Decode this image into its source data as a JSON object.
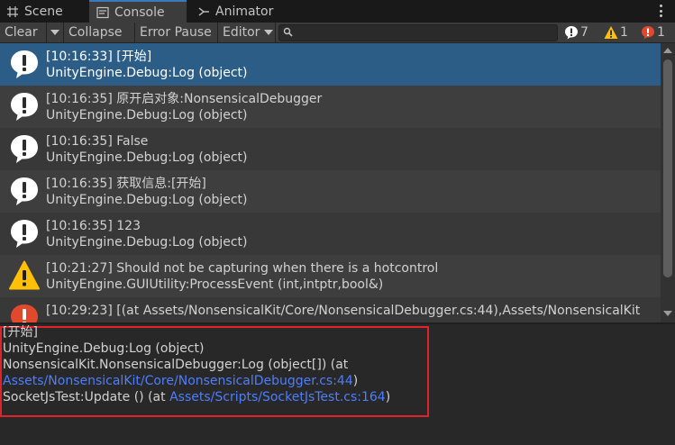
{
  "tabs": [
    {
      "label": "Scene",
      "icon": "scene-grid-icon"
    },
    {
      "label": "Console",
      "icon": "console-icon"
    },
    {
      "label": "Animator",
      "icon": "animator-icon"
    }
  ],
  "toolbar": {
    "clear_label": "Clear",
    "collapse_label": "Collapse",
    "error_pause_label": "Error Pause",
    "editor_label": "Editor",
    "search_placeholder": "",
    "counts": {
      "info": "7",
      "warning": "1",
      "error": "1"
    }
  },
  "colors": {
    "selected_row": "#2c5d87",
    "warning_icon": "#ffc107",
    "error_icon": "#e0492e",
    "link": "#4c7eff",
    "highlight_box": "#e0232a"
  },
  "logs": [
    {
      "type": "info",
      "line1": "[10:16:33] [开始]",
      "line2": "UnityEngine.Debug:Log (object)",
      "selected": true
    },
    {
      "type": "info",
      "line1": "[10:16:35] 原开启对象:NonsensicalDebugger",
      "line2": "UnityEngine.Debug:Log (object)",
      "selected": false
    },
    {
      "type": "info",
      "line1": "[10:16:35] False",
      "line2": "UnityEngine.Debug:Log (object)",
      "selected": false
    },
    {
      "type": "info",
      "line1": "[10:16:35] 获取信息:[开始]",
      "line2": "UnityEngine.Debug:Log (object)",
      "selected": false
    },
    {
      "type": "info",
      "line1": "[10:16:35] 123",
      "line2": "UnityEngine.Debug:Log (object)",
      "selected": false
    },
    {
      "type": "warning",
      "line1": "[10:21:27] Should not be capturing when there is a hotcontrol",
      "line2": "UnityEngine.GUIUtility:ProcessEvent (int,intptr,bool&)",
      "selected": false
    },
    {
      "type": "error",
      "line1": "[10:29:23] [(at Assets/NonsensicalKit/Core/NonsensicalDebugger.cs:44),Assets/NonsensicalKit",
      "line2": "",
      "selected": false
    }
  ],
  "detail": {
    "line1": "[开始]",
    "line2": "UnityEngine.Debug:Log (object)",
    "line3": "NonsensicalKit.NonsensicalDebugger:Log (object[]) (at",
    "line4_link": "Assets/NonsensicalKit/Core/NonsensicalDebugger.cs:44",
    "line4_suffix": ")",
    "line5_prefix": "SocketJsTest:Update () (at ",
    "line5_link": "Assets/Scripts/SocketJsTest.cs:164",
    "line5_suffix": ")"
  }
}
